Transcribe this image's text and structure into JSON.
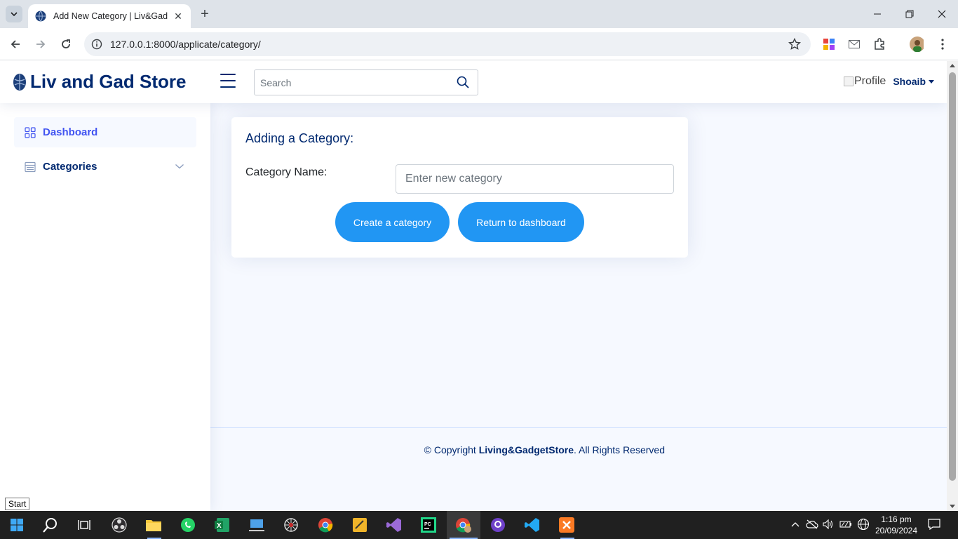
{
  "browser": {
    "tab_title": "Add New Category | Liv&Gad",
    "url": "127.0.0.1:8000/applicate/category/"
  },
  "header": {
    "brand": "Liv and Gad Store",
    "search_placeholder": "Search",
    "profile_alt": "Profile",
    "username": "Shoaib"
  },
  "sidebar": {
    "items": [
      {
        "label": "Dashboard",
        "icon": "grid-icon",
        "active": true
      },
      {
        "label": "Categories",
        "icon": "menu-list-icon",
        "active": false
      }
    ]
  },
  "form": {
    "title": "Adding a Category:",
    "field_label": "Category Name:",
    "field_placeholder": "Enter new category",
    "create_label": "Create a category",
    "return_label": "Return to dashboard"
  },
  "footer": {
    "prefix": "© Copyright ",
    "brand": "Living&GadgetStore",
    "suffix": ". All Rights Reserved"
  },
  "tooltip": "Start",
  "taskbar": {
    "time": "1:16 pm",
    "date": "20/09/2024"
  },
  "colors": {
    "brand": "#012970",
    "accent": "#4154f1",
    "button": "#2196f3",
    "page_bg": "#f6f9ff"
  }
}
